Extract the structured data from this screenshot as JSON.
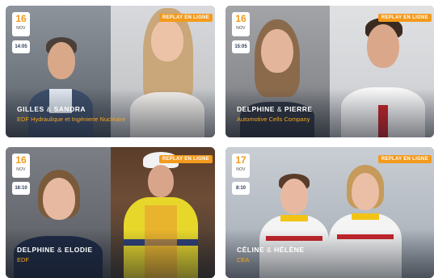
{
  "cards": [
    {
      "day": "16",
      "month": "NOV",
      "time": "14:05",
      "badge": "REPLAY EN LIGNE",
      "name1": "GILLES",
      "amp": "&",
      "name2": "SANDRA",
      "company": "EDF Hydraulique et Ingénierie Nucléaire"
    },
    {
      "day": "16",
      "month": "NOV",
      "time": "15:05",
      "badge": "REPLAY EN LIGNE",
      "name1": "DELPHINE",
      "amp": "&",
      "name2": "PIERRE",
      "company": "Automotive Cells Company"
    },
    {
      "day": "16",
      "month": "NOV",
      "time": "16:10",
      "badge": "REPLAY EN LIGNE",
      "name1": "DELPHINE",
      "amp": "&",
      "name2": "ELODIE",
      "company": "EDF"
    },
    {
      "day": "17",
      "month": "NOV",
      "time": "8:10",
      "badge": "REPLAY EN LIGNE",
      "name1": "CÉLINE",
      "amp": "&",
      "name2": "HÉLÈNE",
      "company": "CEA"
    }
  ],
  "colors": {
    "accent": "#f39a1c",
    "company_text": "#f5a623",
    "time_text": "#2b3a55"
  }
}
